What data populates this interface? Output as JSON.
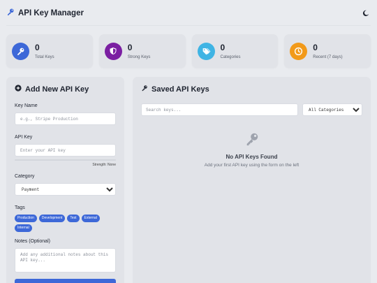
{
  "header": {
    "title": "API Key Manager",
    "logo_icon": "key-icon",
    "theme_toggle_icon": "moon-icon"
  },
  "stats": [
    {
      "value": "0",
      "label": "Total Keys",
      "icon": "key-icon",
      "color": "#3d68d8"
    },
    {
      "value": "0",
      "label": "Strong Keys",
      "icon": "shield-icon",
      "color": "#7b1fa2"
    },
    {
      "value": "0",
      "label": "Categories",
      "icon": "tags-icon",
      "color": "#3fb4e4"
    },
    {
      "value": "0",
      "label": "Recent (7 days)",
      "icon": "clock-icon",
      "color": "#f29a1a"
    }
  ],
  "form": {
    "title": "Add New API Key",
    "name_label": "Key Name",
    "name_placeholder": "e.g., Stripe Production",
    "key_label": "API Key",
    "key_placeholder": "Enter your API key",
    "strength_text": "Strength: None",
    "category_label": "Category",
    "category_selected": "Payment",
    "tags_label": "Tags",
    "tags": [
      "Production",
      "Development",
      "Test",
      "External",
      "Internal"
    ],
    "notes_label": "Notes (Optional)",
    "notes_placeholder": "Add any additional notes about this API key..."
  },
  "saved": {
    "title": "Saved API Keys",
    "search_placeholder": "Search keys...",
    "category_filter": "All Categories",
    "empty_title": "No API Keys Found",
    "empty_subtitle": "Add your first API key using the form on the left"
  },
  "colors": {
    "accent": "#3d68d8",
    "background": "#e9ebef",
    "panel": "#e1e3e8"
  }
}
